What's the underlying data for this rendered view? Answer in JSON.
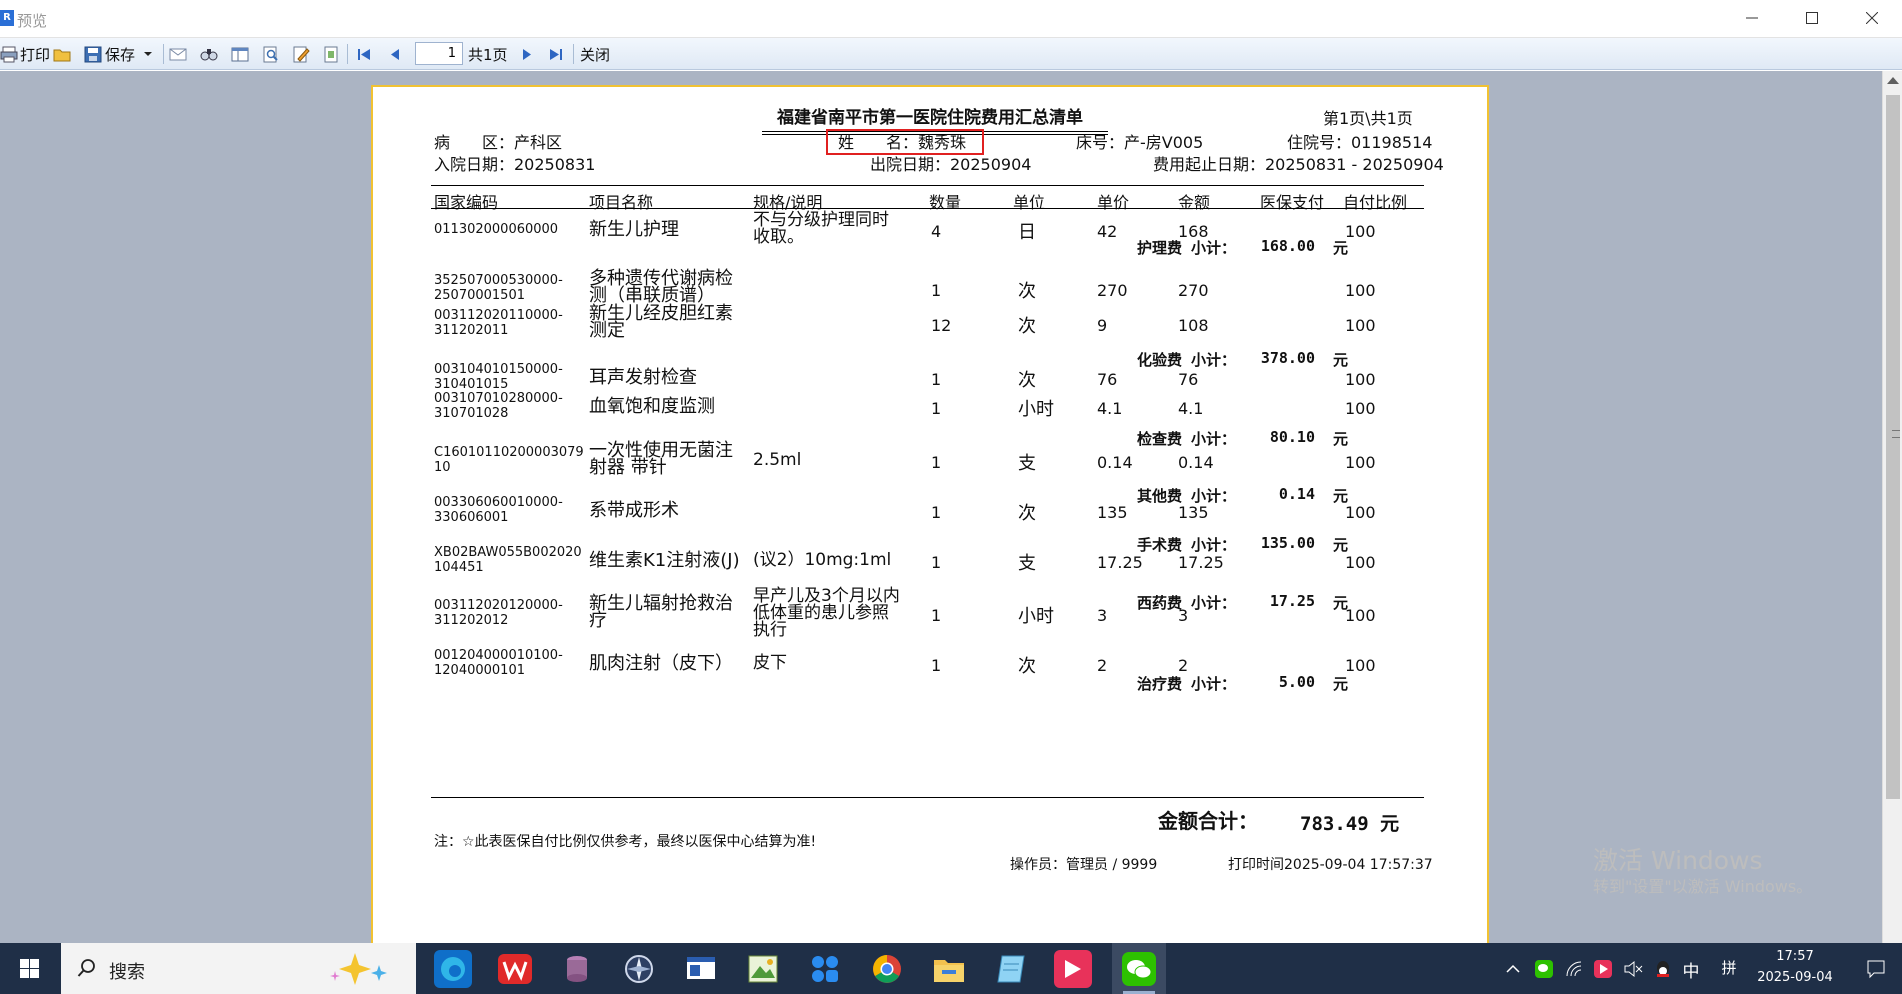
{
  "window": {
    "app_icon": "report-icon",
    "title": "预览",
    "controls": [
      "minimize-icon",
      "maximize-icon",
      "close-icon"
    ]
  },
  "toolbar": {
    "print_label": "打印",
    "save_label": "保存",
    "current_page": "1",
    "total_pages_label": "共1页",
    "close_label": "关闭",
    "icons": [
      "print-icon",
      "open-folder-icon",
      "save-icon",
      "email-icon",
      "find-icon",
      "page-setup-icon",
      "zoom-icon",
      "edit-icon",
      "export-icon",
      "first-page-icon",
      "previous-page-icon",
      "next-page-icon",
      "last-page-icon"
    ]
  },
  "report": {
    "title": "福建省南平市第一医院住院费用汇总清单",
    "page_info": "第1页\\共1页",
    "ward": "病　　区：产科区",
    "name": "姓　　名：魏秀珠",
    "bed": "床号：产-房V005",
    "admission_no": "住院号：01198514",
    "admit_date": "入院日期：20250831",
    "discharge_date": "出院日期：20250904",
    "fee_period": "费用起止日期：20250831 - 20250904",
    "highlight_color": "#e02020",
    "columns": [
      "国家编码",
      "项目名称",
      "规格/说明",
      "数量",
      "单位",
      "单价",
      "金额",
      "医保支付",
      "自付比例"
    ],
    "items": [
      {
        "code": [
          "011302000060000"
        ],
        "name": [
          "新生儿护理"
        ],
        "spec": [
          "不与分级护理同时",
          "收取。"
        ],
        "qty": "4",
        "unit": "日",
        "price": "42",
        "amount": "168",
        "ratio": "100"
      },
      {
        "code": [
          "352507000530000-",
          "25070001501"
        ],
        "name": [
          "多种遗传代谢病检",
          "测（串联质谱）"
        ],
        "spec": [],
        "qty": "1",
        "unit": "次",
        "price": "270",
        "amount": "270",
        "ratio": "100"
      },
      {
        "code": [
          "003112020110000-",
          "311202011"
        ],
        "name": [
          "新生儿经皮胆红素",
          "测定"
        ],
        "spec": [],
        "qty": "12",
        "unit": "次",
        "price": "9",
        "amount": "108",
        "ratio": "100"
      },
      {
        "code": [
          "003104010150000-",
          "310401015"
        ],
        "name": [
          "耳声发射检查"
        ],
        "spec": [],
        "qty": "1",
        "unit": "次",
        "price": "76",
        "amount": "76",
        "ratio": "100"
      },
      {
        "code": [
          "003107010280000-",
          "310701028"
        ],
        "name": [
          "血氧饱和度监测"
        ],
        "spec": [],
        "qty": "1",
        "unit": "小时",
        "price": "4.1",
        "amount": "4.1",
        "ratio": "100"
      },
      {
        "code": [
          "C16010110200003079",
          "10"
        ],
        "name": [
          "一次性使用无菌注",
          "射器 带针"
        ],
        "spec": [
          "2.5ml"
        ],
        "qty": "1",
        "unit": "支",
        "price": "0.14",
        "amount": "0.14",
        "ratio": "100"
      },
      {
        "code": [
          "003306060010000-",
          "330606001"
        ],
        "name": [
          "系带成形术"
        ],
        "spec": [],
        "qty": "1",
        "unit": "次",
        "price": "135",
        "amount": "135",
        "ratio": "100"
      },
      {
        "code": [
          "XB02BAW055B002020",
          "104451"
        ],
        "name": [
          "维生素K1注射液(J)"
        ],
        "spec": [
          "(议2）10mg:1ml"
        ],
        "qty": "1",
        "unit": "支",
        "price": "17.25",
        "amount": "17.25",
        "ratio": "100"
      },
      {
        "code": [
          "003112020120000-",
          "311202012"
        ],
        "name": [
          "新生儿辐射抢救治",
          "疗"
        ],
        "spec": [
          "早产儿及3个月以内",
          "低体重的患儿参照",
          "执行"
        ],
        "qty": "1",
        "unit": "小时",
        "price": "3",
        "amount": "3",
        "ratio": "100"
      },
      {
        "code": [
          "001204000010100-",
          "12040000101"
        ],
        "name": [
          "肌肉注射（皮下）"
        ],
        "spec": [
          "皮下"
        ],
        "qty": "1",
        "unit": "次",
        "price": "2",
        "amount": "2",
        "ratio": "100"
      }
    ],
    "subtotals": [
      {
        "category": "护理费",
        "label": "小计：",
        "value": "168.00",
        "unit": "元"
      },
      {
        "category": "化验费",
        "label": "小计：",
        "value": "378.00",
        "unit": "元"
      },
      {
        "category": "检查费",
        "label": "小计：",
        "value": "80.10",
        "unit": "元"
      },
      {
        "category": "其他费",
        "label": "小计：",
        "value": "0.14",
        "unit": "元"
      },
      {
        "category": "手术费",
        "label": "小计：",
        "value": "135.00",
        "unit": "元"
      },
      {
        "category": "西药费",
        "label": "小计：",
        "value": "17.25",
        "unit": "元"
      },
      {
        "category": "治疗费",
        "label": "小计：",
        "value": "5.00",
        "unit": "元"
      }
    ],
    "total_label": "金额合计：",
    "total_value": "783.49 元",
    "note": "注：☆此表医保自付比例仅供参考，最终以医保中心结算为准!",
    "operator": "操作员：管理员 / 9999",
    "print_time": "打印时间2025-09-04 17:57:37"
  },
  "watermark": {
    "line1": "激活 Windows",
    "line2": "转到\"设置\"以激活 Windows。"
  },
  "taskbar": {
    "search_label": "搜索",
    "ime_lang": "中",
    "ime_mode": "拼",
    "time": "17:57",
    "date": "2025-09-04",
    "pinned_apps": [
      "edge-icon",
      "wps-icon",
      "db-tool-icon",
      "compass-icon",
      "window-app-icon",
      "image-viewer-icon",
      "app-grid-icon",
      "chrome-icon",
      "file-explorer-icon",
      "notes-icon",
      "media-app-icon",
      "wechat-icon"
    ]
  }
}
